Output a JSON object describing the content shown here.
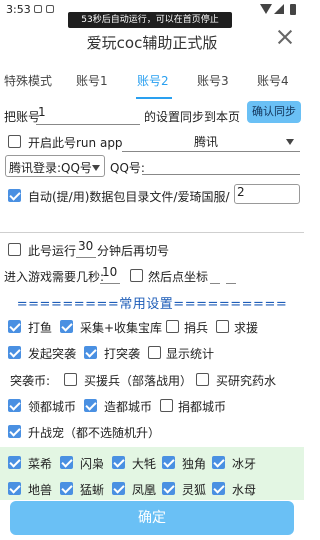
{
  "status": {
    "time": "3:53"
  },
  "toast": {
    "text": "53秒后自动运行，可以在首页停止"
  },
  "header": {
    "title": "爱玩coc辅助正式版"
  },
  "tabs": [
    "特殊模式",
    "账号1",
    "账号2",
    "账号3",
    "账号4"
  ],
  "sync": {
    "prefix": "把账号",
    "value": "1",
    "suffix": "的设置同步到本页",
    "button": "确认同步"
  },
  "run": {
    "label": "开启此号run app",
    "app": "腾讯"
  },
  "login": {
    "mode": "腾讯登录:QQ号",
    "qq_label": "QQ号:",
    "qq_value": ""
  },
  "data_dir": {
    "label": "自动(提/用)数据包目录文件/爱琦国服/",
    "value": "2"
  },
  "switch": {
    "prefix": "此号运行",
    "minutes": "30",
    "suffix": "分钟后再切号"
  },
  "entry": {
    "prefix": "进入游戏需要几秒:",
    "seconds": "10",
    "coords_label": "然后点坐标"
  },
  "section": {
    "title": "=========常用设置=========="
  },
  "opts1": {
    "a": "打鱼",
    "b": "采集+收集宝库",
    "c": "捐兵",
    "d": "求援"
  },
  "opts2": {
    "a": "发起突袭",
    "b": "打突袭",
    "c": "显示统计"
  },
  "raid": {
    "label": "突袭币:",
    "a": "买援兵（部落战用）",
    "b": "买研究药水"
  },
  "city": {
    "a": "领都城币",
    "b": "造都城币",
    "c": "捐都城币"
  },
  "pet": {
    "label": "升战宠（都不选随机升）"
  },
  "pets_row1": [
    "菜希",
    "闪枭",
    "大牦",
    "独角",
    "冰牙"
  ],
  "pets_row2": [
    "地兽",
    "猛蜥",
    "凤凰",
    "灵狐",
    "水母"
  ],
  "confirm": {
    "label": "确定"
  },
  "colors": {
    "accent": "#2aa0f0",
    "button": "#6ac0f5",
    "panel": "#e3f6e3"
  }
}
